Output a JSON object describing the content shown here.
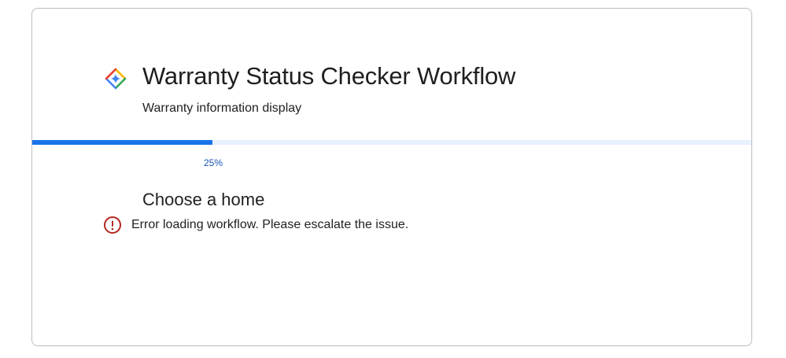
{
  "workflow": {
    "title": "Warranty Status Checker Workflow",
    "subtitle": "Warranty information display",
    "logo_icon": "gemini-diamond-icon"
  },
  "progress": {
    "percent": 25,
    "label": "25%",
    "fill_color": "#1a73e8",
    "track_color": "#e8f0fe"
  },
  "step": {
    "heading": "Choose a home"
  },
  "error": {
    "icon": "error-circle-icon",
    "message": "Error loading workflow. Please escalate the issue.",
    "color": "#b3261e"
  }
}
